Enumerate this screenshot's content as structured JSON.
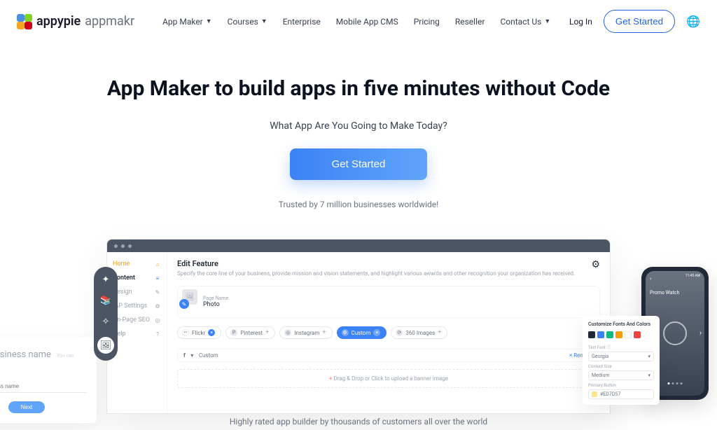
{
  "logo": {
    "text1": "appypie",
    "text2": "appmakr"
  },
  "nav": {
    "app_maker": "App Maker",
    "courses": "Courses",
    "enterprise": "Enterprise",
    "mobile_cms": "Mobile App CMS",
    "pricing": "Pricing",
    "reseller": "Reseller",
    "contact": "Contact Us"
  },
  "header": {
    "login": "Log In",
    "get_started": "Get Started"
  },
  "hero": {
    "title": "App Maker to build apps in five minutes without Code",
    "subtitle": "What App Are You Going to Make Today?",
    "cta": "Get Started",
    "trusted": "Trusted by 7 million businesses worldwide!"
  },
  "mockup": {
    "sidebar": {
      "home": "Home",
      "content": "Content",
      "design": "Design",
      "app_settings": "IAP Settings",
      "on_page_seo": "On-Page SEO",
      "help": "Help"
    },
    "panel": {
      "title": "Edit Feature",
      "desc": "Specify the core line of your business, provide mission and vision statements, and highlight various awards and other recognition your organization has received.",
      "page_name_label": "Page Name",
      "page_name_value": "Photo"
    },
    "chips": {
      "flickr": "Flickr",
      "pinterest": "Pinterest",
      "instagram": "Instagram",
      "custom": "Custom",
      "360": "360 Images"
    },
    "custom_row": {
      "label": "Custom",
      "remove": "Remove"
    },
    "upload": {
      "text": "Drag & Drop or Click to upload a banner image",
      "click": "Click"
    }
  },
  "card_left": {
    "title": "Enter business name",
    "hint": "You can change it later",
    "placeholder": "Enter business name",
    "button": "Next"
  },
  "card_right": {
    "title": "Customize Fonts And Colors",
    "text_font_label": "Text Font",
    "text_font_value": "Georgia",
    "content_size_label": "Content Size",
    "content_size_value": "Medium",
    "primary_button_label": "Primary Button",
    "color": "#ED7D57",
    "swatches": [
      "#1f2937",
      "#3b82f6",
      "#10b981",
      "#f59e0b",
      "#ffffff",
      "#ef4444"
    ]
  },
  "phone": {
    "time": "11:45 AM",
    "title": "Promo Watch"
  },
  "tagline": "Highly rated app builder by thousands of customers all over the world"
}
